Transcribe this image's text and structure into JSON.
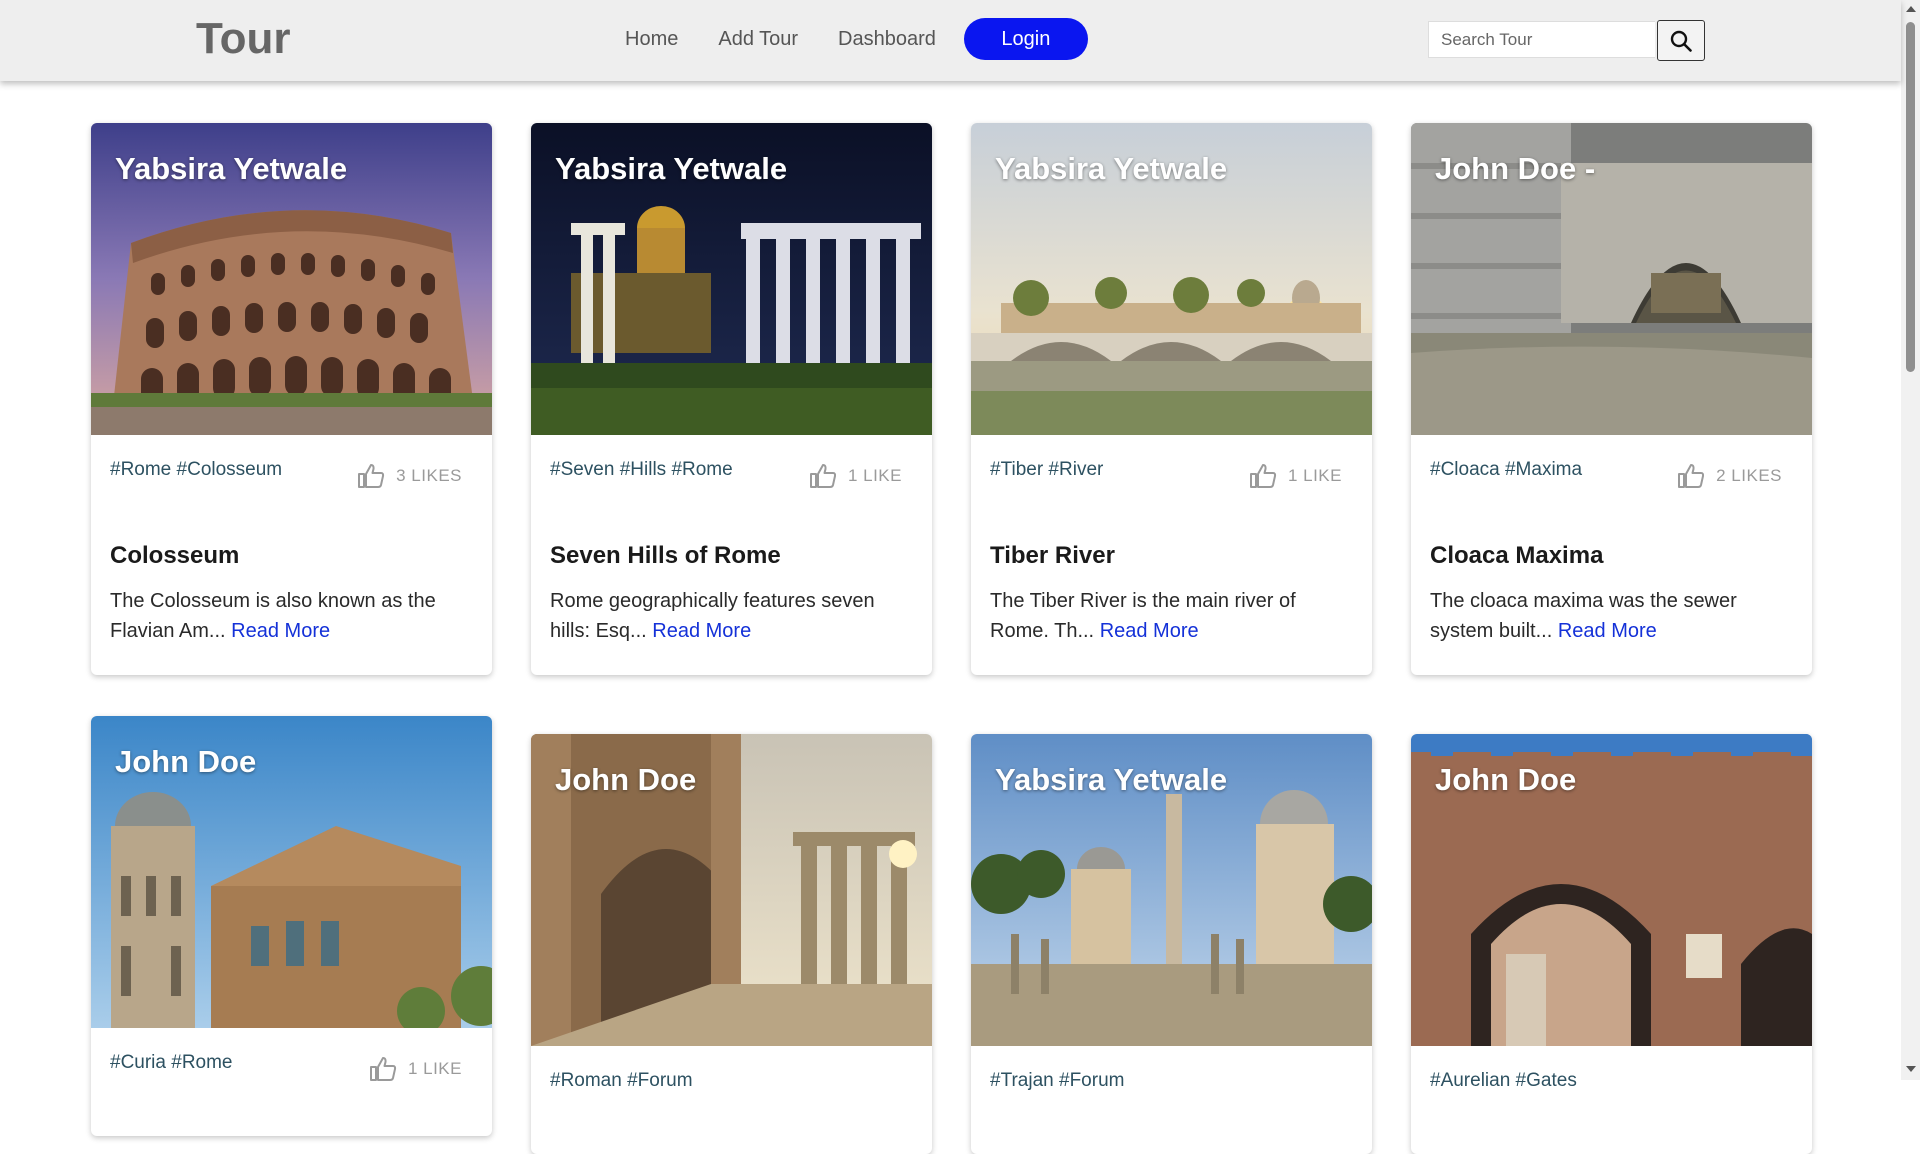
{
  "nav": {
    "brand": "Tour",
    "links": [
      "Home",
      "Add Tour",
      "Dashboard"
    ],
    "login": "Login",
    "search_placeholder": "Search Tour"
  },
  "read_more_label": "Read More",
  "cards": [
    {
      "author": "Yabsira Yetwale",
      "tags": "#Rome #Colosseum",
      "likes": "3 LIKES",
      "title": "Colosseum",
      "excerpt": "The Colosseum is also known as the Flavian Am...",
      "image": "colosseum-photo"
    },
    {
      "author": "Yabsira Yetwale",
      "tags": "#Seven #Hills #Rome",
      "likes": "1 LIKE",
      "title": "Seven Hills of Rome",
      "excerpt": "Rome geographically features seven hills: Esq...",
      "image": "roman-forum-night-photo"
    },
    {
      "author": "Yabsira Yetwale",
      "tags": "#Tiber #River",
      "likes": "1 LIKE",
      "title": "Tiber River",
      "excerpt": "The Tiber River is the main river of Rome. Th...",
      "image": "tiber-bridge-photo"
    },
    {
      "author": "John Doe  -",
      "tags": "#Cloaca #Maxima",
      "likes": "2 LIKES",
      "title": "Cloaca Maxima",
      "excerpt": "The cloaca maxima was the sewer system built...",
      "image": "cloaca-arch-photo"
    },
    {
      "author": "John Doe",
      "tags": "#Curia #Rome",
      "likes": "1 LIKE",
      "image": "curia-photo"
    },
    {
      "author": "John Doe",
      "tags": "#Roman #Forum",
      "image": "forum-arch-photo"
    },
    {
      "author": "Yabsira Yetwale",
      "tags": "#Trajan #Forum",
      "image": "trajan-forum-photo"
    },
    {
      "author": "John Doe",
      "tags": "#Aurelian #Gates",
      "image": "aurelian-gate-photo"
    }
  ]
}
